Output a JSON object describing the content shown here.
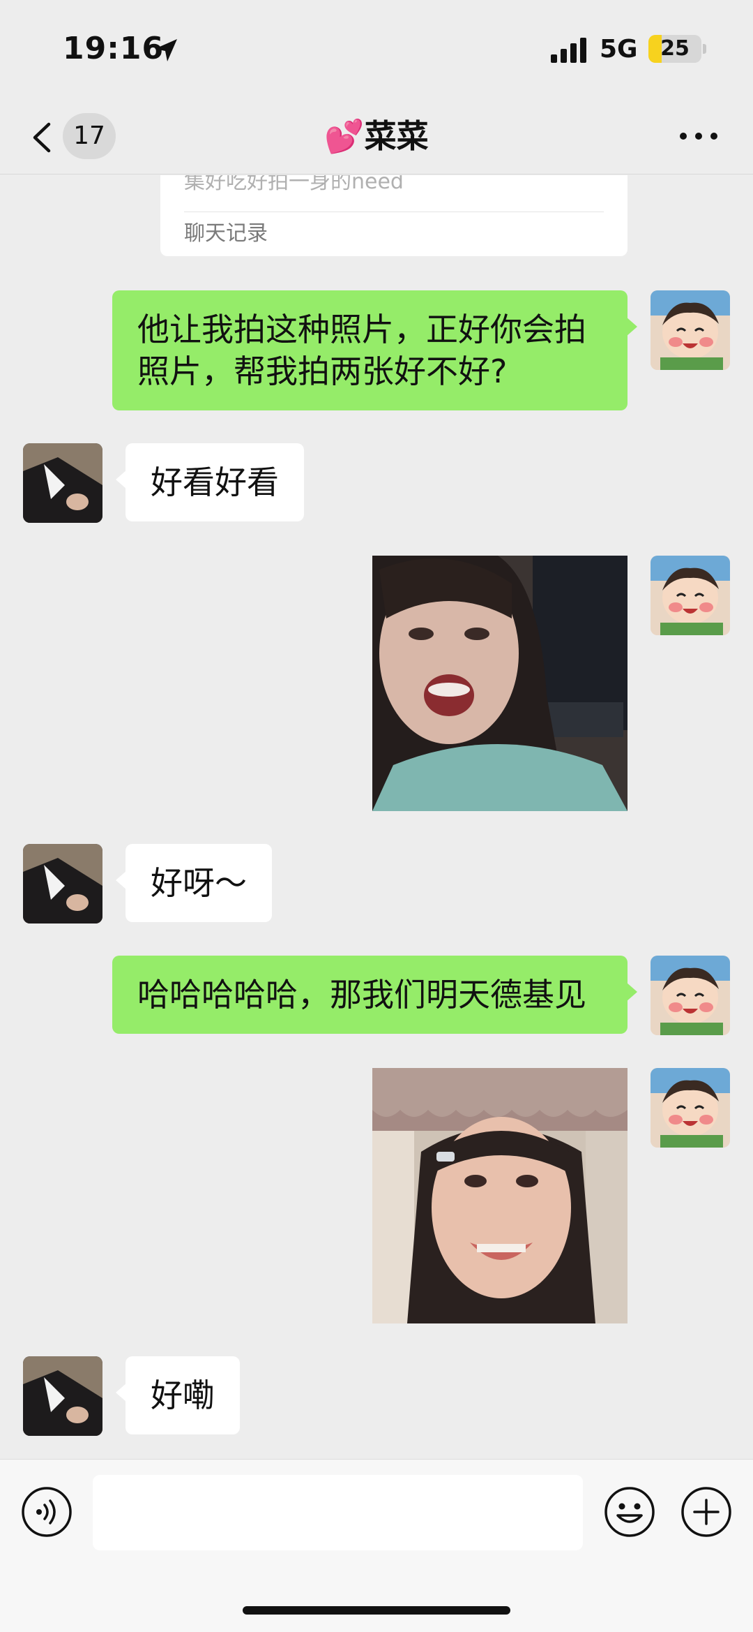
{
  "status_bar": {
    "time": "19:16",
    "location_icon": "location-arrow-icon",
    "signal_icon": "cellular-signal-icon",
    "network": "5G",
    "battery_level": "25",
    "battery_fill_percent": 25,
    "battery_color": "#f7d21e"
  },
  "nav": {
    "back_icon": "chevron-left-icon",
    "unread_count": "17",
    "title": "💕菜菜",
    "more_icon": "more-dots-icon"
  },
  "chat": {
    "forwarded_card": {
      "preview_text": "集好吃好拍一身的need",
      "footer_label": "聊天记录"
    },
    "messages": [
      {
        "sender": "me",
        "type": "text",
        "text": "他让我拍这种照片，正好你会拍照片，帮我拍两张好不好?"
      },
      {
        "sender": "other",
        "type": "text",
        "text": "好看好看"
      },
      {
        "sender": "me",
        "type": "image",
        "image": "selfie-photo-open-mouth"
      },
      {
        "sender": "other",
        "type": "text",
        "text": "好呀～"
      },
      {
        "sender": "me",
        "type": "text",
        "text": "哈哈哈哈哈，那我们明天德基见"
      },
      {
        "sender": "me",
        "type": "image",
        "image": "selfie-photo-smiling"
      },
      {
        "sender": "other",
        "type": "text",
        "text": "好嘞"
      }
    ]
  },
  "input_bar": {
    "voice_icon": "voice-input-icon",
    "emoji_icon": "emoji-smile-icon",
    "plus_icon": "plus-circle-icon",
    "placeholder": ""
  },
  "colors": {
    "background": "#ededed",
    "my_bubble": "#95ec69",
    "other_bubble": "#ffffff"
  }
}
